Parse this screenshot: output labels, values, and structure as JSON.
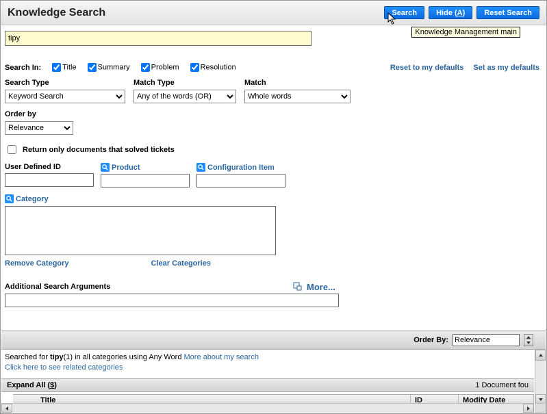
{
  "header": {
    "title": "Knowledge Search",
    "search_label": "Search",
    "hide_label_pre": "Hide (",
    "hide_label_key": "A",
    "hide_label_post": ")",
    "reset_label": "Reset Search",
    "tooltip": "Knowledge Management main"
  },
  "search_value": "tipy",
  "search_in": {
    "label": "Search In:",
    "opts": [
      "Title",
      "Summary",
      "Problem",
      "Resolution"
    ],
    "checked": [
      true,
      true,
      true,
      true
    ]
  },
  "links": {
    "reset_defaults": "Reset to my defaults",
    "set_defaults": "Set as my defaults",
    "remove_category": "Remove Category",
    "clear_categories": "Clear Categories",
    "more": "More...",
    "more_about": "More about my search",
    "related": "Click here to see related categories"
  },
  "labels": {
    "search_type": "Search Type",
    "match_type": "Match Type",
    "match": "Match",
    "order_by": "Order by",
    "return_only": "Return only documents that solved tickets",
    "user_defined_id": "User Defined ID",
    "product": "Product",
    "config_item": "Configuration Item",
    "category": "Category",
    "additional": "Additional Search Arguments",
    "order_by2": "Order By:",
    "expand_all": "Expand All (",
    "expand_key": "$",
    "expand_all_end": ")",
    "doc_count": "1 Document fou"
  },
  "selects": {
    "search_type": "Keyword Search",
    "match_type": "Any of the words (OR)",
    "match": "Whole words",
    "order_by": "Relevance",
    "order_by2": "Relevance"
  },
  "checks": {
    "return_only": false
  },
  "results": {
    "prefix": "Searched for ",
    "term": "tipy",
    "suffix": "(1) in all categories using Any Word "
  },
  "columns": {
    "title": "Title",
    "id": "ID",
    "modify": "Modify Date"
  }
}
